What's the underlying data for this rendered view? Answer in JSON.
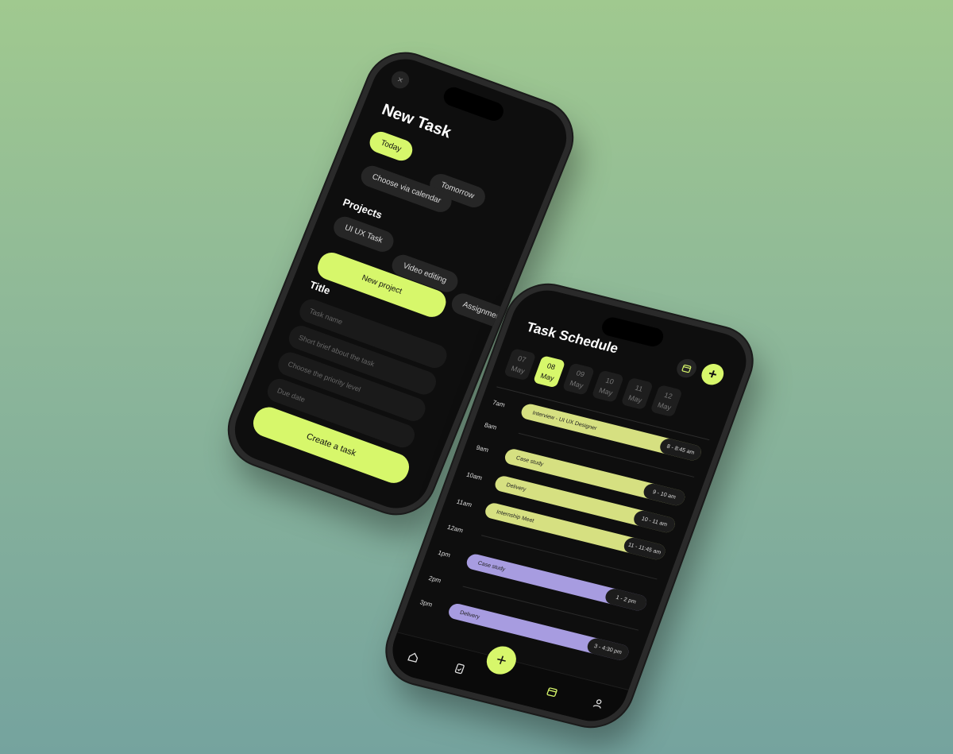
{
  "new_task": {
    "close_icon": "×",
    "title": "New Task",
    "date_chips": [
      "Today",
      "Tomorrow",
      "Choose via calendar"
    ],
    "projects_label": "Projects",
    "project_chips": [
      "UI UX Task",
      "Video editing",
      "Assignmen",
      "New project"
    ],
    "title_label": "Title",
    "fields": [
      "Task name",
      "Short brief about the task",
      "Choose the priority level",
      "Due date"
    ],
    "create_button": "Create a task",
    "accent": "#d7f76b"
  },
  "schedule": {
    "title": "Task Schedule",
    "dates": [
      {
        "day": "07",
        "month": "May"
      },
      {
        "day": "08",
        "month": "May"
      },
      {
        "day": "09",
        "month": "May"
      },
      {
        "day": "10",
        "month": "May"
      },
      {
        "day": "11",
        "month": "May"
      },
      {
        "day": "12",
        "month": "May"
      }
    ],
    "times": [
      "7am",
      "8am",
      "9am",
      "10am",
      "11am",
      "12am",
      "1pm",
      "2pm",
      "3pm"
    ],
    "events": [
      {
        "title": "Interview - UI UX Designer",
        "time": "8 - 8:45 am"
      },
      {
        "title": "Case study",
        "time": "9 - 10 am"
      },
      {
        "title": "Delivery",
        "time": "10 - 11 am"
      },
      {
        "title": "Internship Meet",
        "time": "11 - 11:45 am"
      },
      {
        "title": "Case study",
        "time": "1 - 2 pm"
      },
      {
        "title": "Delivery",
        "time": "3 - 4:30 pm"
      }
    ],
    "fab_plus": "+",
    "nav_icons": [
      "home-icon",
      "document-icon",
      "calendar-icon",
      "profile-icon"
    ],
    "event_colors": {
      "lime": "#d6e081",
      "purple": "#a79ce0"
    }
  }
}
